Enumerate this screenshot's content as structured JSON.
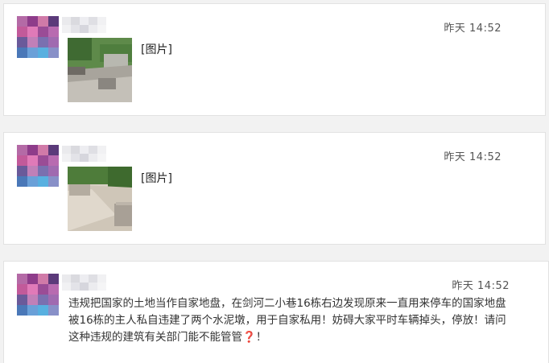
{
  "posts": [
    {
      "time": "昨天  14:52",
      "image_label": "[图片]",
      "icons": {
        "avatar": "pixelated-avatar",
        "thumbnail": "photo-thumbnail"
      }
    },
    {
      "time": "昨天  14:52",
      "image_label": "[图片]",
      "icons": {
        "avatar": "pixelated-avatar",
        "thumbnail": "photo-thumbnail"
      }
    },
    {
      "time": "昨天  14:52",
      "text": "违规把国家的土地当作自家地盘，在剑河二小巷16栋右边发现原来一直用来停车的国家地盘被16栋的主人私自违建了两个水泥墩，用于自家私用！妨碍大家平时车辆掉头，停放！请问这种违规的建筑有关部门能不能管管",
      "emoji": "❓",
      "tail": "！",
      "icons": {
        "avatar": "pixelated-avatar",
        "emoji": "red-question-mark"
      }
    }
  ],
  "colors": {
    "background": "#f2f2f2",
    "card": "#ffffff",
    "border": "#e2e2e2",
    "time_text": "#555555",
    "body_text": "#333333",
    "question_mark": "#c8102e"
  }
}
